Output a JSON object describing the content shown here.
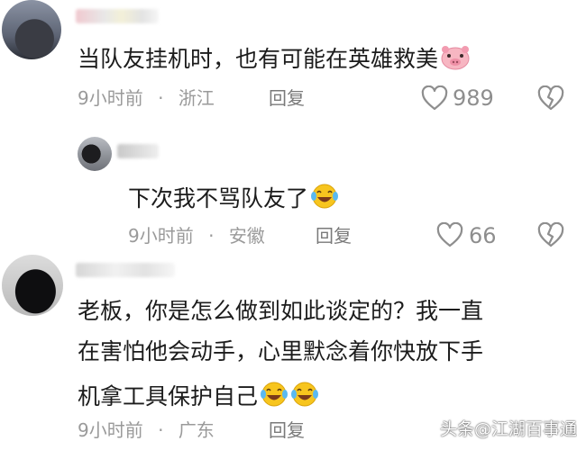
{
  "comments": [
    {
      "text": "当队友挂机时，也有可能在英雄救美",
      "emoji": "pig-face",
      "time": "9小时前",
      "location": "浙江",
      "reply_label": "回复",
      "likes": "989"
    },
    {
      "text": "下次我不骂队友了",
      "emoji": "laughing-tears",
      "time": "9小时前",
      "location": "安徽",
      "reply_label": "回复",
      "likes": "66"
    },
    {
      "lines": [
        "老板，你是怎么做到如此谈定的？我一直",
        "在害怕他会动手，心里默念着你快放下手",
        "机拿工具保护自己"
      ],
      "emoji": "laughing-tears",
      "time": "9小时前",
      "location": "广东",
      "reply_label": "回复"
    }
  ],
  "separator": "·",
  "watermark": "头条@江湖百事通",
  "colors": {
    "text": "#1c1c1c",
    "meta": "#9a9a9a",
    "emoji": "#f7c51e"
  }
}
